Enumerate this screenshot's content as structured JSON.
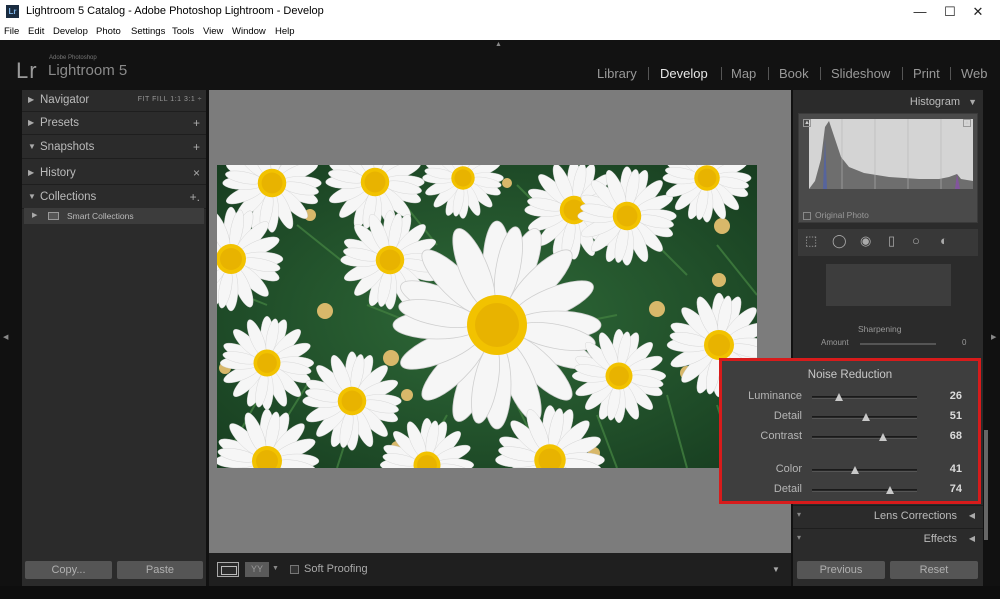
{
  "window": {
    "title": "Lightroom 5 Catalog - Adobe Photoshop Lightroom - Develop",
    "app_icon": "Lr",
    "controls": {
      "minimize": "—",
      "maximize": "☐",
      "close": "✕"
    }
  },
  "menu": [
    "File",
    "Edit",
    "Develop",
    "Photo",
    "Settings",
    "Tools",
    "View",
    "Window",
    "Help"
  ],
  "brand": {
    "logo": "Lr",
    "company": "Adobe Photoshop",
    "product": "Lightroom 5"
  },
  "modules": [
    {
      "label": "Library",
      "active": false
    },
    {
      "label": "Develop",
      "active": true
    },
    {
      "label": "Map",
      "active": false
    },
    {
      "label": "Book",
      "active": false
    },
    {
      "label": "Slideshow",
      "active": false
    },
    {
      "label": "Print",
      "active": false
    },
    {
      "label": "Web",
      "active": false
    }
  ],
  "left_panel": {
    "navigator": {
      "label": "Navigator",
      "options": "FIT   FILL   1:1   3:1 ÷"
    },
    "presets": {
      "label": "Presets",
      "action": "+"
    },
    "snapshots": {
      "label": "Snapshots",
      "action": "+"
    },
    "history": {
      "label": "History",
      "action": "×"
    },
    "collections": {
      "label": "Collections",
      "action": "+."
    },
    "smart_collections": "Smart Collections",
    "copy_button": "Copy...",
    "paste_button": "Paste"
  },
  "toolbar": {
    "yy": "YY",
    "soft_proofing": "Soft Proofing"
  },
  "right_panel": {
    "histogram_label": "Histogram",
    "original_photo": "Original Photo",
    "sharpening_title": "Sharpening",
    "sharpening_amount_label": "Amount",
    "sharpening_amount_value": "0",
    "lens_corrections": "Lens Corrections",
    "effects": "Effects",
    "previous_button": "Previous",
    "reset_button": "Reset"
  },
  "noise_reduction": {
    "title": "Noise Reduction",
    "sliders": [
      {
        "label": "Luminance",
        "value": "26",
        "fraction": 0.26
      },
      {
        "label": "Detail",
        "value": "51",
        "fraction": 0.51
      },
      {
        "label": "Contrast",
        "value": "68",
        "fraction": 0.68
      },
      {
        "label": "Color",
        "value": "41",
        "fraction": 0.41
      },
      {
        "label": "Detail",
        "value": "74",
        "fraction": 0.74
      }
    ]
  },
  "colors": {
    "highlight_border": "#d71b1b",
    "daisy_center": "#f2c200",
    "foliage": "#2a5a32"
  }
}
